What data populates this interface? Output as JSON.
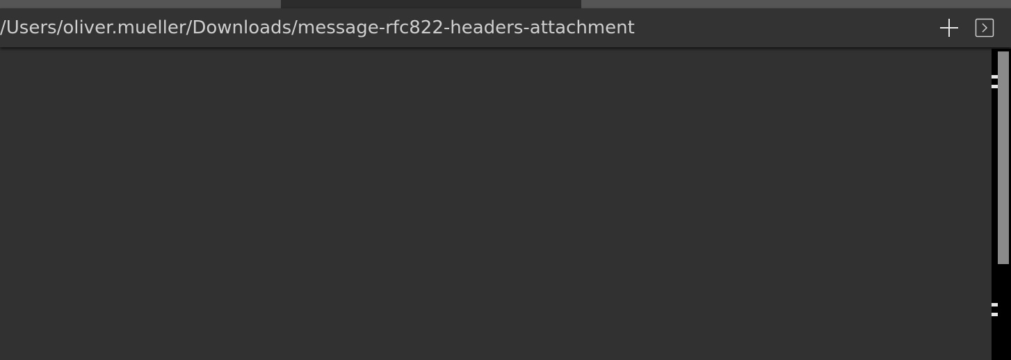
{
  "tabs": [
    {
      "state": "inactive"
    },
    {
      "state": "active"
    },
    {
      "state": "inactive"
    }
  ],
  "path_bar": {
    "path": "/Users/oliver.mueller/Downloads/message-rfc822-headers-attachment",
    "new_button_icon": "plus-icon",
    "expand_button_icon": "chevron-right-box-icon"
  },
  "colors": {
    "background": "#313131",
    "path_bar": "#333333",
    "text": "#cfcfcf",
    "scrollbar_track": "#000000",
    "scrollbar_thumb": "#8a8a8a"
  }
}
